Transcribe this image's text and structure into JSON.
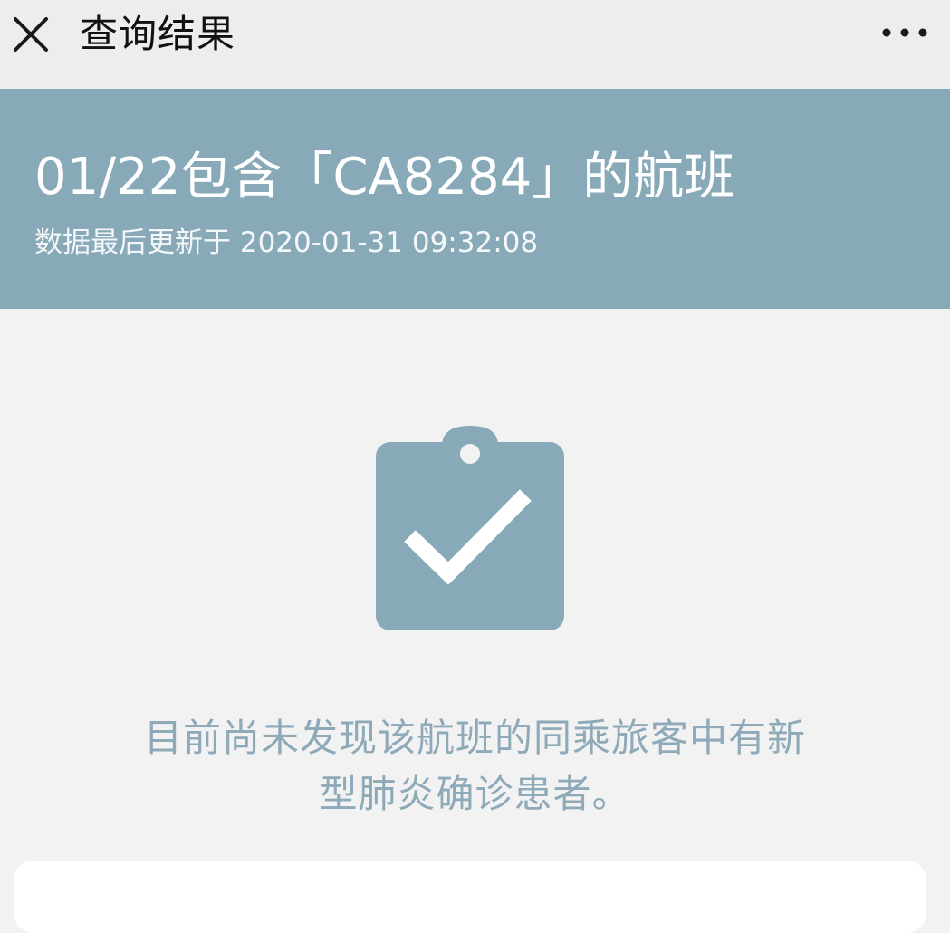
{
  "topbar": {
    "title": "查询结果",
    "close_icon": "close-icon",
    "more_icon": "more-dots-icon"
  },
  "header": {
    "title": "01/22包含「CA8284」的航班",
    "subtitle": "数据最后更新于 2020-01-31 09:32:08",
    "background_color": "#88a9b8"
  },
  "result": {
    "icon": "clipboard-check-icon",
    "icon_color": "#88a9b8",
    "message_line1": "目前尚未发现该航班的同乘旅客中有新",
    "message_line2": "型肺炎确诊患者。"
  }
}
